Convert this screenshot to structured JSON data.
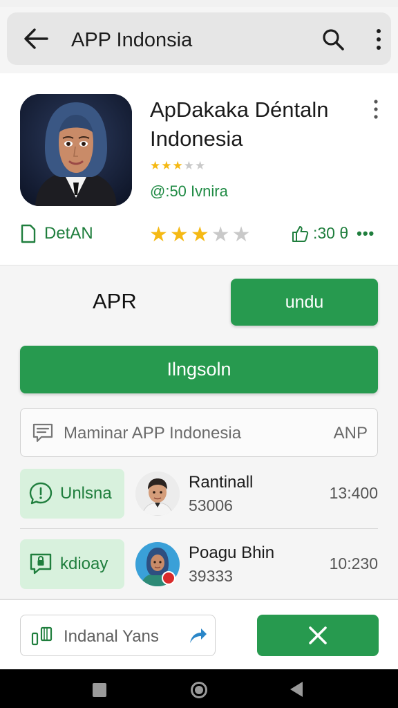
{
  "toolbar": {
    "title": "APP Indonsia",
    "icons": [
      "back-arrow-icon",
      "search-icon",
      "more-vert-icon"
    ]
  },
  "app": {
    "name": "ApDakaka Déntaln Indonesia",
    "small_rating": {
      "filled": 3,
      "total": 5
    },
    "meta": "@:50 Ivnira",
    "detail_label": "DetAN",
    "rating": {
      "filled": 3,
      "total": 5
    },
    "likes": ":30 θ",
    "likes_more": "•••"
  },
  "actions": {
    "apr_label": "APR",
    "undu_label": "undu",
    "install_label": "Ilngsoln"
  },
  "review": {
    "placeholder": "Maminar APP Indonesia",
    "trailing": "ANP"
  },
  "list": [
    {
      "chip_label": "Unlsna",
      "chip_icon": "alert-chat-icon",
      "name": "Rantinall",
      "number": "53006",
      "time": "13:400"
    },
    {
      "chip_label": "kdioay",
      "chip_icon": "lock-chat-icon",
      "name": "Poagu Bhin",
      "number": "39333",
      "time": "10:230"
    }
  ],
  "bottom": {
    "share_text": "Indanal Yans",
    "share_icon": "bookmark-icon",
    "share_arrow_icon": "share-arrow-icon",
    "close_icon": "close-icon"
  },
  "colors": {
    "accent": "#279a4f",
    "accent_text": "#1f7e3d",
    "chip_bg": "#d8f1dd",
    "star": "#f5b914"
  }
}
